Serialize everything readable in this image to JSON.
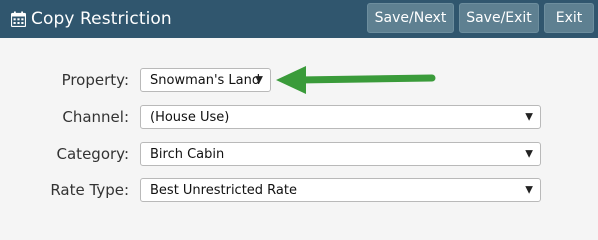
{
  "header": {
    "title": "Copy Restriction",
    "title_icon": "calendar-icon",
    "buttons": {
      "save_next": "Save/Next",
      "save_exit": "Save/Exit",
      "exit": "Exit"
    }
  },
  "form": {
    "property": {
      "label": "Property:",
      "value": "Snowman's Land"
    },
    "channel": {
      "label": "Channel:",
      "value": "(House Use)"
    },
    "category": {
      "label": "Category:",
      "value": "Birch Cabin"
    },
    "rate_type": {
      "label": "Rate Type:",
      "value": "Best Unrestricted Rate"
    }
  },
  "colors": {
    "header_bg": "#30566e",
    "button_bg": "#5e8091",
    "page_bg": "#f5f5f5",
    "annotation_arrow": "#3a9b3a"
  }
}
